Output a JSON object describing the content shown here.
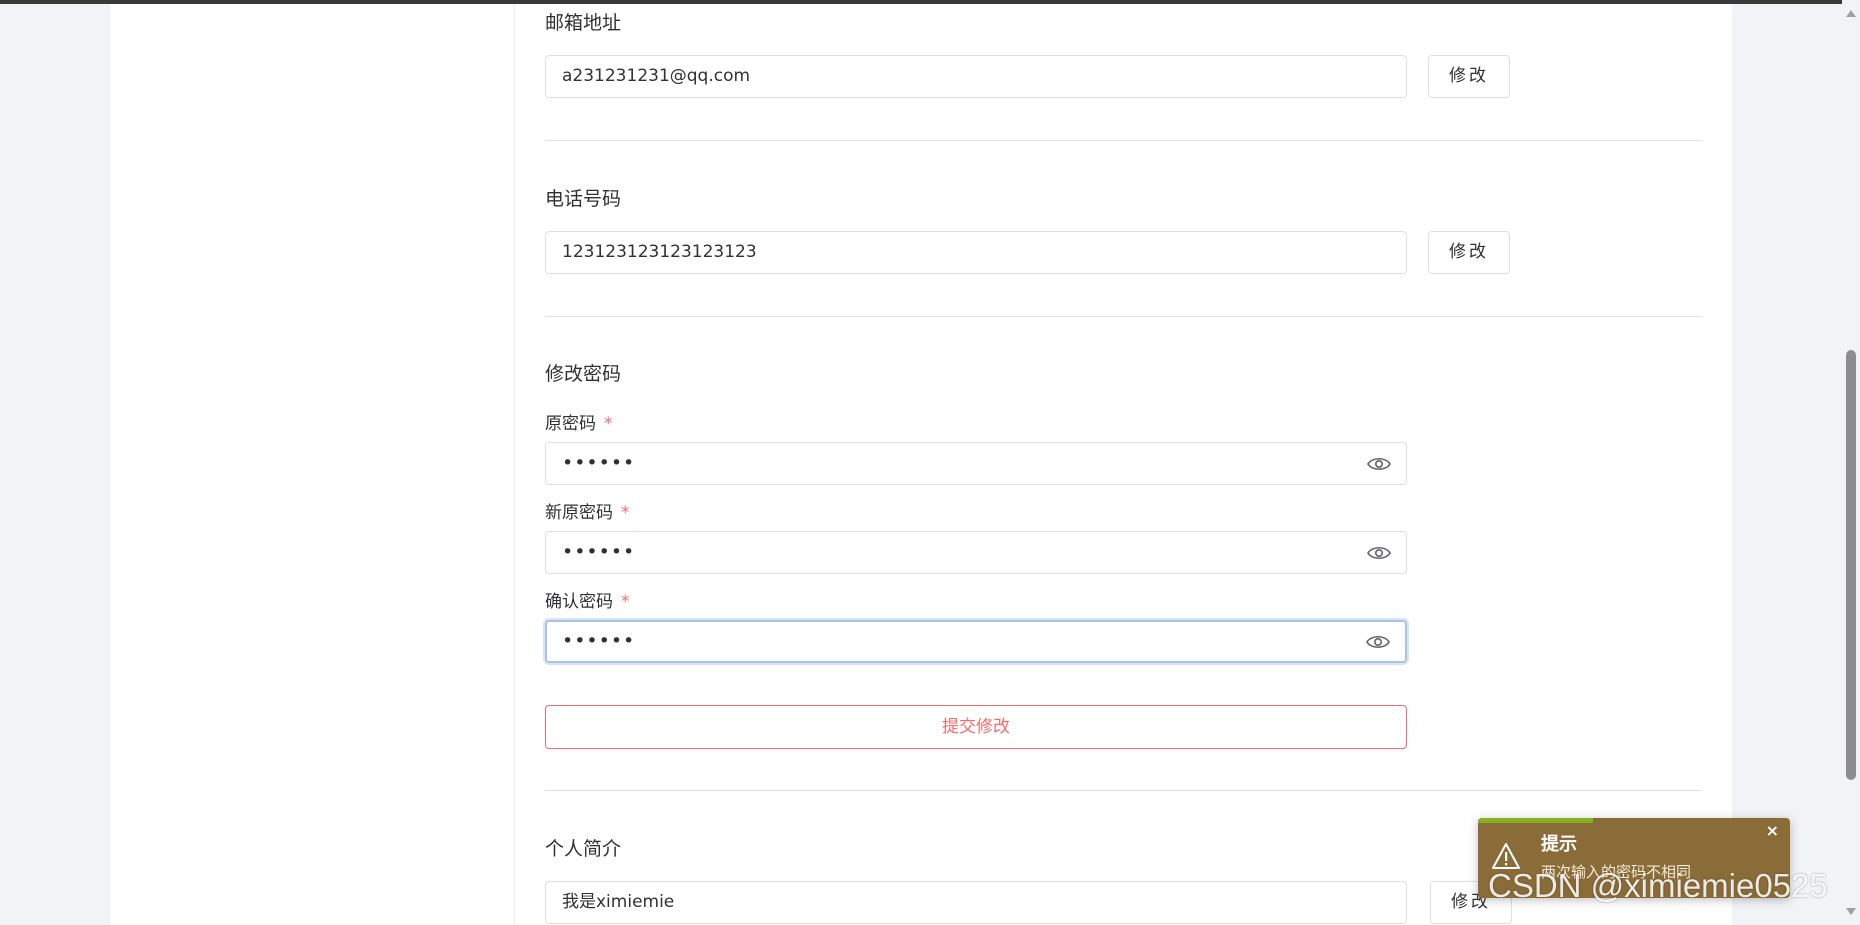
{
  "email": {
    "title": "邮箱地址",
    "value": "a231231231@qq.com",
    "edit_label": "修改"
  },
  "phone": {
    "title": "电话号码",
    "value": "123123123123123123",
    "edit_label": "修改"
  },
  "password": {
    "title": "修改密码",
    "old_label": "原密码",
    "new_label": "新原密码",
    "confirm_label": "确认密码",
    "required_mark": "*",
    "old_value": "••••••",
    "new_value": "••••••",
    "confirm_value": "••••••",
    "submit_label": "提交修改"
  },
  "bio": {
    "title": "个人简介",
    "value": "我是ximiemie",
    "edit_label": "修改"
  },
  "toast": {
    "title": "提示",
    "message": "两次输入的密码不相同",
    "close_symbol": "×",
    "icon": "warning-icon",
    "progress": 0.37
  },
  "watermark": "CSDN @ximiemie0525",
  "colors": {
    "danger": "#f56c6c",
    "toast_bg": "#8a6c38",
    "toast_progress": "#86b11f",
    "focus_border": "#a9c3e8"
  }
}
